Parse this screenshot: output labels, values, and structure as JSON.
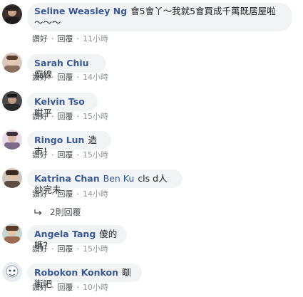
{
  "labels": {
    "like": "讚好",
    "reply": "回覆",
    "separator": "·"
  },
  "comments": [
    {
      "author": "Seline Weasley Ng",
      "text": "會5會丫～我就5會買成千萬既居屋啦～～～",
      "time": "11小時"
    },
    {
      "author": "Sarah Chiu",
      "text": "痴線",
      "time": "14小時"
    },
    {
      "author": "Kelvin Tso",
      "text": "咁平",
      "time": "15小時"
    },
    {
      "author": "Ringo Lun",
      "text": "造市！",
      "time": "15小時"
    },
    {
      "author": "Katrina Chan",
      "mention": "Ben Ku",
      "text": "cls d人炒完未",
      "time": "14小時",
      "replies_label": "2則回覆"
    },
    {
      "author": "Angela Tang",
      "text": "傻的嗎？",
      "time": "15小時"
    },
    {
      "author": "Robokon Konkon",
      "text": "瞓街吧",
      "time": "10小時"
    }
  ]
}
